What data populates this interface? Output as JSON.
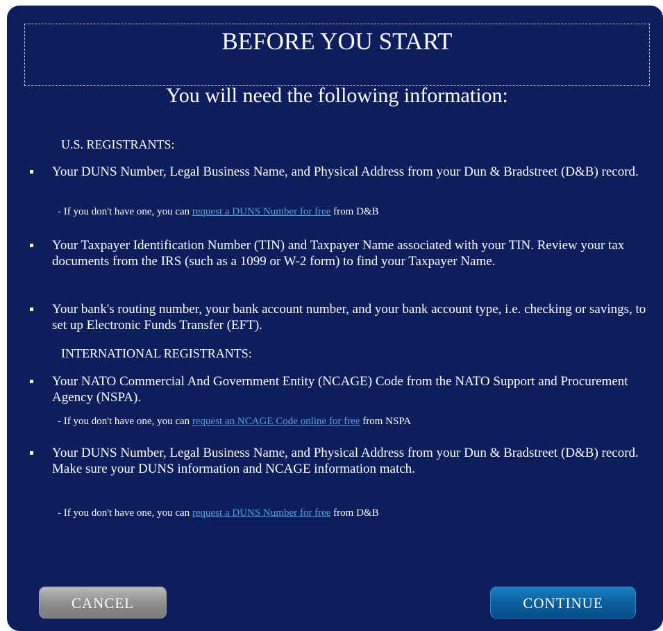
{
  "header": {
    "title": "BEFORE YOU START",
    "subtitle": "You will need the following information:"
  },
  "us": {
    "heading": "U.S. REGISTRANTS:",
    "items": [
      {
        "text": "Your DUNS Number, Legal Business Name, and Physical Address from your Dun & Bradstreet (D&B) record.",
        "note_prefix": "- If you don't have one, you can ",
        "note_link": "request a DUNS Number for free",
        "note_suffix": " from D&B"
      },
      {
        "text": "Your Taxpayer Identification Number (TIN) and Taxpayer Name associated with your TIN. Review your tax documents from the IRS (such as a 1099 or W-2 form) to find your Taxpayer Name."
      },
      {
        "text": "Your bank's routing number, your bank account number, and your bank account type, i.e. checking or savings, to set up Electronic Funds Transfer (EFT)."
      }
    ]
  },
  "intl": {
    "heading": "INTERNATIONAL REGISTRANTS:",
    "items": [
      {
        "text": "Your NATO Commercial And Government Entity (NCAGE) Code from the NATO Support and Procurement Agency (NSPA).",
        "note_prefix": "- If you don't have one, you can ",
        "note_link": "request an NCAGE Code online for free",
        "note_suffix": " from NSPA"
      },
      {
        "text": "Your DUNS Number, Legal Business Name, and Physical Address from your Dun & Bradstreet (D&B) record. Make sure your DUNS information and NCAGE information match.",
        "note_prefix": "- If you don't have one, you can ",
        "note_link": "request a DUNS Number for free",
        "note_suffix": " from D&B"
      }
    ]
  },
  "buttons": {
    "cancel": "CANCEL",
    "continue": "CONTINUE"
  },
  "colors": {
    "panel_bg": "#0c1f5c",
    "link": "#4fa3d8",
    "cancel_button": "#8c8c8c",
    "continue_button": "#0a5d9c"
  }
}
